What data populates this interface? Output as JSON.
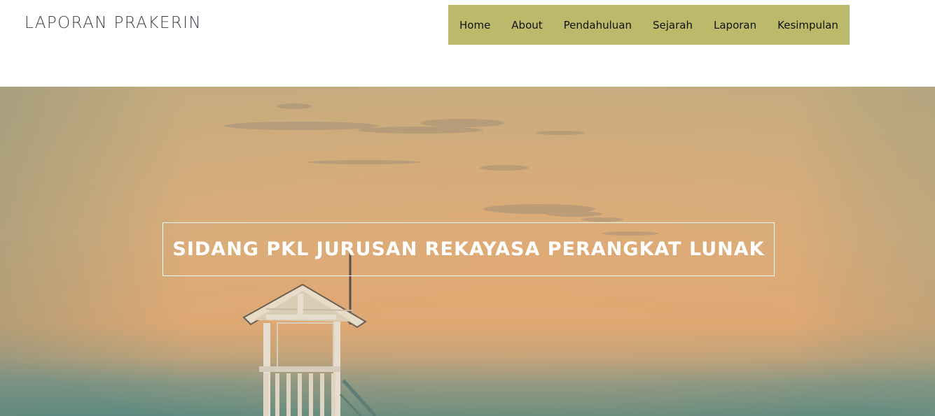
{
  "header": {
    "brand": "LAPORAN PRAKERIN",
    "nav": [
      "Home",
      "About",
      "Pendahuluan",
      "Sejarah",
      "Laporan",
      "Kesimpulan"
    ]
  },
  "hero": {
    "title": "SIDANG PKL JURUSAN REKAYASA PERANGKAT LUNAK",
    "image": "lifeguard-tower-sunset-photo"
  },
  "colors": {
    "nav_bg": "#bcb96a",
    "sky_top": "#c6a87a",
    "sky_mid": "#d9ad7a",
    "sea": "#5e8a80"
  }
}
